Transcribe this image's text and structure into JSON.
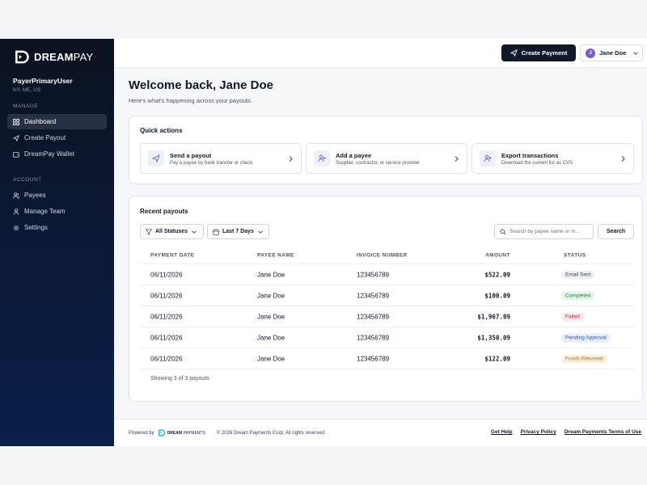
{
  "brand": {
    "name_bold": "DREAM",
    "name_light": "PAY"
  },
  "sidebar": {
    "user_name": "PayerPrimaryUser",
    "user_location": "NY, ME, US",
    "manage_label": "Manage",
    "manage_items": [
      {
        "label": "Dashboard",
        "icon": "grid-icon",
        "active": true
      },
      {
        "label": "Create Payout",
        "icon": "send-icon"
      },
      {
        "label": "DreamPay Wallet",
        "icon": "wallet-icon"
      }
    ],
    "account_label": "Account",
    "account_items": [
      {
        "label": "Payees",
        "icon": "users-icon"
      },
      {
        "label": "Manage Team",
        "icon": "user-icon"
      },
      {
        "label": "Settings",
        "icon": "gear-icon"
      }
    ]
  },
  "topbar": {
    "create_payment_label": "Create Payment",
    "user_initial": "J",
    "user_name": "Jane Doe"
  },
  "welcome": {
    "title": "Welcome back, Jane Doe",
    "subtitle": "Here's what's happening across your payouts."
  },
  "quick_actions": {
    "title": "Quick actions",
    "items": [
      {
        "title": "Send a payout",
        "desc": "Pay a payee by bank transfer or check",
        "icon": "send-icon"
      },
      {
        "title": "Add a payee",
        "desc": "Supplier, contractor, or service provider",
        "icon": "user-plus-icon"
      },
      {
        "title": "Export transactions",
        "desc": "Download the current list as CVS",
        "icon": "user-plus-icon"
      }
    ]
  },
  "recent_payouts": {
    "title": "Recent payouts",
    "filter_status": "All Statuses",
    "filter_date": "Last 7 Days",
    "search_placeholder": "Search by payee name or in...",
    "search_button": "Search",
    "columns": [
      "Payment Date",
      "Payee Name",
      "Invoice Number",
      "Amount",
      "Status"
    ],
    "rows": [
      {
        "date": "06/11/2026",
        "payee": "Jane Doe",
        "invoice": "123456789",
        "amount": "$522.09",
        "status": "Email Sent",
        "status_bg": "#eef0f4",
        "status_fg": "#374151"
      },
      {
        "date": "06/11/2026",
        "payee": "Jane Doe",
        "invoice": "123456789",
        "amount": "$100.09",
        "status": "Completed",
        "status_bg": "#e3f6ea",
        "status_fg": "#1f7a45"
      },
      {
        "date": "06/11/2026",
        "payee": "Jane Doe",
        "invoice": "123456789",
        "amount": "$1,967.09",
        "status": "Failed",
        "status_bg": "#fde7ea",
        "status_fg": "#b42335"
      },
      {
        "date": "06/11/2026",
        "payee": "Jane Doe",
        "invoice": "123456789",
        "amount": "$1,350.09",
        "status": "Pending Approval",
        "status_bg": "#e6edfb",
        "status_fg": "#2f57b8"
      },
      {
        "date": "06/11/2026",
        "payee": "Jane Doe",
        "invoice": "123456789",
        "amount": "$122.09",
        "status": "Funds Returned",
        "status_bg": "#fdf0dc",
        "status_fg": "#b46a11"
      }
    ],
    "showing": "Showing 3 of 3 payouts"
  },
  "footer": {
    "powered_by": "Powered by",
    "mini_brand_bold": "DREAM",
    "mini_brand_light": "PAYMENTS",
    "copyright": "© 2026 Dream Payments Corp. All rights reserved.",
    "links": [
      "Get Help",
      "Privacy Policy",
      "Dream Payments Terms of Use"
    ]
  }
}
